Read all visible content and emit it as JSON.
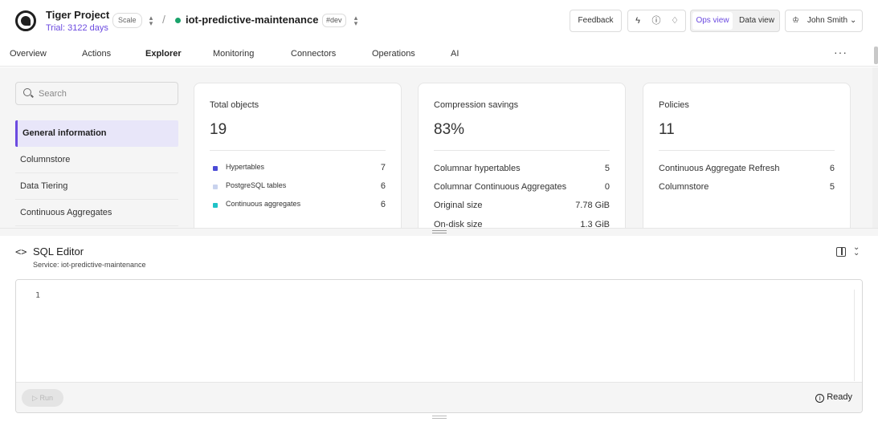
{
  "header": {
    "project_name": "Tiger Project",
    "trial": "Trial: 3122 days",
    "plan": "Scale",
    "separator": "/",
    "service_name": "iot-predictive-maintenance",
    "env_badge": "#dev",
    "feedback_label": "Feedback",
    "ops_view_label": "Ops view",
    "data_view_label": "Data view",
    "user_name": "John Smith",
    "status_color": "#1aa36b",
    "accent_color": "#6c4be0"
  },
  "nav": {
    "tabs": [
      {
        "label": "Overview"
      },
      {
        "label": "Actions"
      },
      {
        "label": "Explorer"
      },
      {
        "label": "Monitoring"
      },
      {
        "label": "Connectors"
      },
      {
        "label": "Operations"
      },
      {
        "label": "AI"
      }
    ],
    "active_tab": "Explorer",
    "more_label": "···"
  },
  "sidebar": {
    "search_placeholder": "Search",
    "items": [
      {
        "label": "General information"
      },
      {
        "label": "Columnstore"
      },
      {
        "label": "Data Tiering"
      },
      {
        "label": "Continuous Aggregates"
      }
    ],
    "active_item": "General information"
  },
  "cards": {
    "total": {
      "title": "Total objects",
      "value": "19",
      "rows": [
        {
          "label": "Hypertables",
          "value": "7",
          "color": "#4b4bd6"
        },
        {
          "label": "PostgreSQL tables",
          "value": "6",
          "color": "#c9d3ee"
        },
        {
          "label": "Continuous aggregates",
          "value": "6",
          "color": "#1fc2c7"
        }
      ]
    },
    "compression": {
      "title": "Compression savings",
      "value": "83%",
      "rows": [
        {
          "label": "Columnar hypertables",
          "value": "5"
        },
        {
          "label": "Columnar Continuous Aggregates",
          "value": "0"
        },
        {
          "label": "Original size",
          "value": "7.78 GiB"
        },
        {
          "label": "On-disk size",
          "value": "1.3 GiB"
        }
      ]
    },
    "policies": {
      "title": "Policies",
      "value": "11",
      "rows": [
        {
          "label": "Continuous Aggregate Refresh",
          "value": "6"
        },
        {
          "label": "Columnstore",
          "value": "5"
        }
      ]
    }
  },
  "sql_editor": {
    "icon_text": "<>",
    "title": "SQL Editor",
    "service_label": "Service: iot-predictive-maintenance",
    "line_number": "1",
    "run_label": "Run",
    "status": "Ready"
  }
}
